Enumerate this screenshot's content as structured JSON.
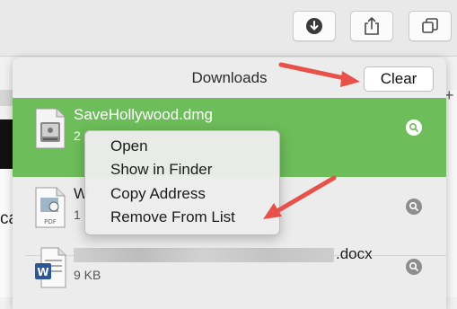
{
  "popover": {
    "title": "Downloads",
    "clear_label": "Clear"
  },
  "downloads": [
    {
      "name": "SaveHollywood.dmg",
      "size": "2",
      "icon": "dmg-file-icon",
      "selected": true
    },
    {
      "name": "W",
      "size": "1",
      "icon": "pdf-file-icon",
      "selected": false
    },
    {
      "name": ".docx",
      "size": "9 KB",
      "icon": "word-file-icon",
      "selected": false
    }
  ],
  "context_menu": {
    "items": [
      "Open",
      "Show in Finder",
      "Copy Address",
      "Remove From List"
    ]
  },
  "background": {
    "fragment_left": "ca"
  },
  "colors": {
    "selected_row": "#6dbd5a",
    "annotation_arrow": "#e8504a",
    "toolbar": "#e9e9e9"
  }
}
